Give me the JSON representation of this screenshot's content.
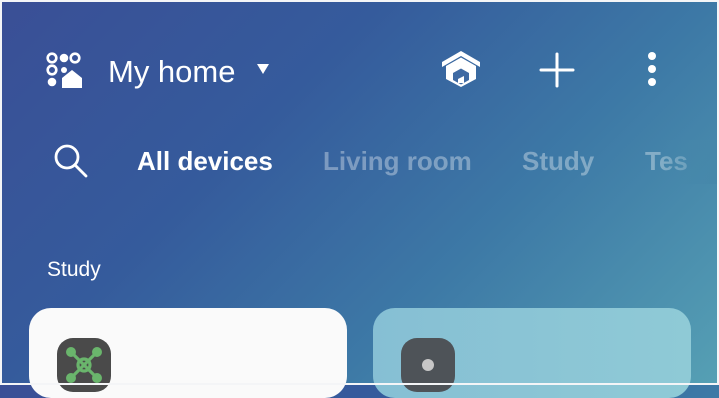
{
  "header": {
    "home_name": "My home",
    "icons": {
      "home_menu": "qr-home-icon",
      "home_dropdown": "caret-down-icon",
      "home_view": "house-3d-icon",
      "add": "plus-icon",
      "more": "more-vertical-icon"
    }
  },
  "tabs": {
    "search_icon": "search-icon",
    "items": [
      {
        "label": "All devices",
        "active": true
      },
      {
        "label": "Living room",
        "active": false
      },
      {
        "label": "Study",
        "active": false
      },
      {
        "label": "Tes",
        "active": false
      }
    ]
  },
  "section": {
    "label": "Study"
  },
  "devices": [
    {
      "icon": "hub-network-icon",
      "icon_color": "#6ab56c"
    },
    {
      "icon": "device-dot-icon",
      "icon_color": "#c7c7c7"
    }
  ],
  "colors": {
    "background_start": "#3a4f96",
    "background_end": "#56a0b4",
    "card_light": "#fafafa",
    "card_teal": "#8ac4d5"
  }
}
